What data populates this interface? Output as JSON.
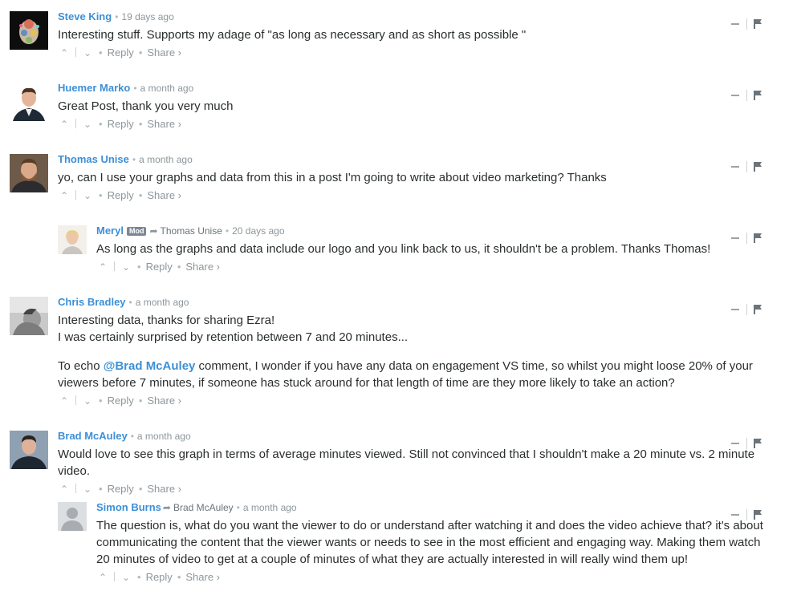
{
  "ui": {
    "reply_label": "Reply",
    "share_label": "Share ›",
    "upvote_icon": "⌃",
    "downvote_icon": "⌄",
    "reply_arrow": "➦",
    "accent_color": "#3d8fd6"
  },
  "comments": [
    {
      "author": "Steve King",
      "time": "19 days ago",
      "text": "Interesting stuff. Supports my adage of \"as long as necessary and as short as possible \""
    },
    {
      "author": "Huemer Marko",
      "time": "a month ago",
      "text": "Great Post, thank you very much"
    },
    {
      "author": "Thomas Unise",
      "time": "a month ago",
      "text": "yo, can I use your graphs and data from this in a post I'm going to write about video marketing? Thanks"
    },
    {
      "author": "Meryl",
      "badge": "Mod",
      "reply_to": "Thomas Unise",
      "time": "20 days ago",
      "text": "As long as the graphs and data include our logo and you link back to us, it shouldn't be a problem. Thanks Thomas!"
    },
    {
      "author": "Chris Bradley",
      "time": "a month ago",
      "line1": "Interesting data, thanks for sharing Ezra!",
      "line2": "I was certainly surprised by retention between 7 and 20 minutes...",
      "p2_prefix": "To echo ",
      "mention": "@Brad McAuley",
      "p2_suffix": " comment, I wonder if you have any data on engagement VS time, so whilst you might loose 20% of your viewers before 7 minutes, if someone has stuck around for that length of time are they more likely to take an action?"
    },
    {
      "author": "Brad McAuley",
      "time": "a month ago",
      "text": "Would love to see this graph in terms of average minutes viewed. Still not convinced that I shouldn't make a 20 minute vs. 2 minute video."
    },
    {
      "author": "Simon Burns",
      "reply_to": "Brad McAuley",
      "time": "a month ago",
      "text": "The question is, what do you want the viewer to do or understand after watching it and does the video achieve that? it's about communicating the content that the viewer wants or needs to see in the most efficient and engaging way. Making them watch 20 minutes of video to get at a couple of minutes of what they are actually interested in will really wind them up!"
    }
  ]
}
